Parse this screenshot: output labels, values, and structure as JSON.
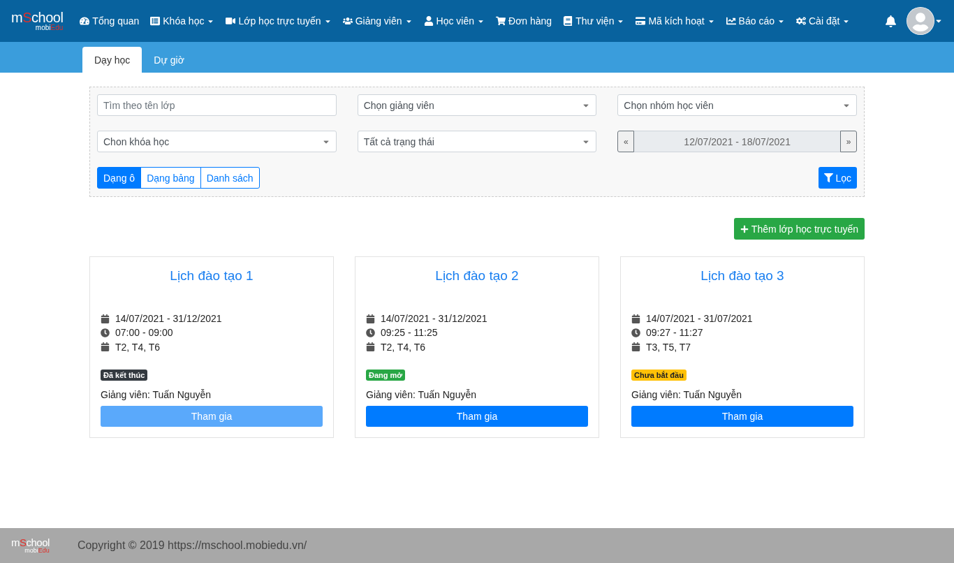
{
  "logo": {
    "main": [
      {
        "text": "m",
        "accent": false
      },
      {
        "text": "S",
        "accent": true
      },
      {
        "text": "chool",
        "accent": false
      }
    ],
    "sub": [
      {
        "text": "mobi",
        "accent": false
      },
      {
        "text": "Edu",
        "accent": true
      }
    ]
  },
  "nav": [
    {
      "label": "Tổng quan",
      "dropdown": false
    },
    {
      "label": "Khóa học",
      "dropdown": true
    },
    {
      "label": "Lớp học trực tuyến",
      "dropdown": true
    },
    {
      "label": "Giảng viên",
      "dropdown": true
    },
    {
      "label": "Học viên",
      "dropdown": true
    },
    {
      "label": "Đơn hàng",
      "dropdown": false
    },
    {
      "label": "Thư viện",
      "dropdown": true
    },
    {
      "label": "Mã kích hoạt",
      "dropdown": true
    },
    {
      "label": "Báo cáo",
      "dropdown": true
    },
    {
      "label": "Cài đặt",
      "dropdown": true
    }
  ],
  "tabs": [
    {
      "label": "Dạy học",
      "selected": true
    },
    {
      "label": "Dự giờ",
      "selected": false
    }
  ],
  "filters": {
    "search": {
      "placeholder": "Tìm theo tên lớp"
    },
    "selects": [
      {
        "value": "Chọn giảng viên"
      },
      {
        "value": "Chọn nhóm học viên"
      },
      {
        "value": "Chon khóa học"
      },
      {
        "value": "Tất cả trạng thái"
      }
    ],
    "date_range": {
      "prev": "«",
      "value": "12/07/2021 - 18/07/2021",
      "next": "»"
    },
    "views": [
      {
        "label": "Dạng ô",
        "selected": true
      },
      {
        "label": "Dạng bảng",
        "selected": false
      },
      {
        "label": "Danh sách",
        "selected": false
      }
    ],
    "filter_button": "Lọc"
  },
  "add_button": "Thêm lớp học trực tuyến",
  "cards": [
    {
      "title": "Lịch đào tạo 1",
      "dates": "14/07/2021 - 31/12/2021",
      "time": "07:00 - 09:00",
      "days": "T2, T4, T6",
      "status": {
        "label": "Đã kết thúc",
        "color": "#343a40"
      },
      "teacher": "Giảng viên: Tuấn Nguyễn",
      "button": {
        "label": "Tham gia",
        "disabled": true
      }
    },
    {
      "title": "Lịch đào tạo 2",
      "dates": "14/07/2021 - 31/12/2021",
      "time": "09:25 - 11:25",
      "days": "T2, T4, T6",
      "status": {
        "label": "Đang mở",
        "color": "#28a745"
      },
      "teacher": "Giảng viên: Tuấn Nguyễn",
      "button": {
        "label": "Tham gia",
        "disabled": false
      }
    },
    {
      "title": "Lịch đào tạo 3",
      "dates": "14/07/2021 - 31/07/2021",
      "time": "09:27 - 11:27",
      "days": "T3, T5, T7",
      "status": {
        "label": "Chưa bắt đầu",
        "color": "#ffc107"
      },
      "teacher": "Giảng viên: Tuấn Nguyễn",
      "button": {
        "label": "Tham gia",
        "disabled": false
      }
    }
  ],
  "footer": {
    "logo": {
      "main": [
        {
          "text": "m",
          "accent": false
        },
        {
          "text": "S",
          "accent": true
        },
        {
          "text": "chool",
          "accent": false
        }
      ],
      "sub": [
        {
          "text": "mobi",
          "accent": false
        },
        {
          "text": "Edu",
          "accent": true
        }
      ]
    },
    "copyright": "Copyright © 2019 https://mschool.mobiedu.vn/"
  }
}
